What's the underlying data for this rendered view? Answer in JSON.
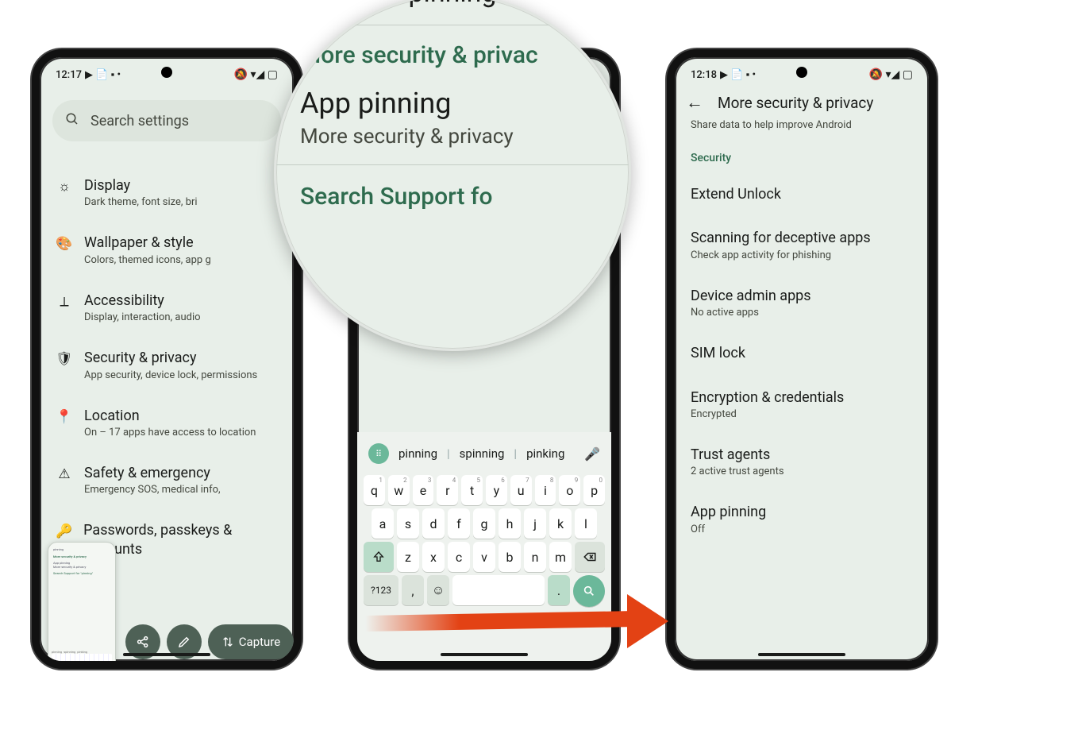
{
  "status": {
    "time1": "12:17",
    "time3": "12:18",
    "icons_left": "▶ 📄 ▪ •",
    "icons_right": "🔕 ▾◢ ▢"
  },
  "phone1": {
    "search_placeholder": "Search settings",
    "items": [
      {
        "title": "Display",
        "sub": "Dark theme, font size, bri",
        "icon": "☼"
      },
      {
        "title": "Wallpaper & style",
        "sub": "Colors, themed icons, app g",
        "icon": "🎨"
      },
      {
        "title": "Accessibility",
        "sub": "Display, interaction, audio",
        "icon": "⟂"
      },
      {
        "title": "Security & privacy",
        "sub": "App security, device lock, permissions",
        "icon": "🛡"
      },
      {
        "title": "Location",
        "sub": "On – 17 apps have access to location",
        "icon": "📍"
      },
      {
        "title": "Safety & emergency",
        "sub": "Emergency SOS, medical info,",
        "icon": "⚠"
      },
      {
        "title": "Passwords, passkeys & accounts",
        "sub": "",
        "icon": "🔑"
      }
    ],
    "thumb": {
      "q": "pinning",
      "s1": "More security & privacy",
      "r1": "App pinning",
      "r1s": "More security & privacy",
      "s2": "Search Support for \"pinning\"",
      "sg1": "pinning",
      "sg2": "spinning",
      "sg3": "pinking"
    },
    "actions": {
      "capture": "Capture"
    }
  },
  "phone2": {
    "suggestions": {
      "a": "pinning",
      "b": "spinning",
      "c": "pinking"
    },
    "keys_r1": [
      "q",
      "w",
      "e",
      "r",
      "t",
      "y",
      "u",
      "i",
      "o",
      "p"
    ],
    "keys_r1_sup": [
      "1",
      "2",
      "3",
      "4",
      "5",
      "6",
      "7",
      "8",
      "9",
      "0"
    ],
    "keys_r2": [
      "a",
      "s",
      "d",
      "f",
      "g",
      "h",
      "j",
      "k",
      "l"
    ],
    "keys_r3": [
      "z",
      "x",
      "c",
      "v",
      "b",
      "n",
      "m"
    ],
    "sym": "?123",
    "comma": ",",
    "period": "."
  },
  "phone3": {
    "title": "More security & privacy",
    "hint": "Share data to help improve Android",
    "section": "Security",
    "items": [
      {
        "title": "Extend Unlock",
        "sub": ""
      },
      {
        "title": "Scanning for deceptive apps",
        "sub": "Check app activity for phishing"
      },
      {
        "title": "Device admin apps",
        "sub": "No active apps"
      },
      {
        "title": "SIM lock",
        "sub": ""
      },
      {
        "title": "Encryption & credentials",
        "sub": "Encrypted"
      },
      {
        "title": "Trust agents",
        "sub": "2 active trust agents"
      },
      {
        "title": "App pinning",
        "sub": "Off"
      }
    ]
  },
  "magnifier": {
    "query": "pinning",
    "section": "More security & privac",
    "result_title": "App pinning",
    "result_sub": "More security & privacy",
    "support": "Search Support fo"
  }
}
